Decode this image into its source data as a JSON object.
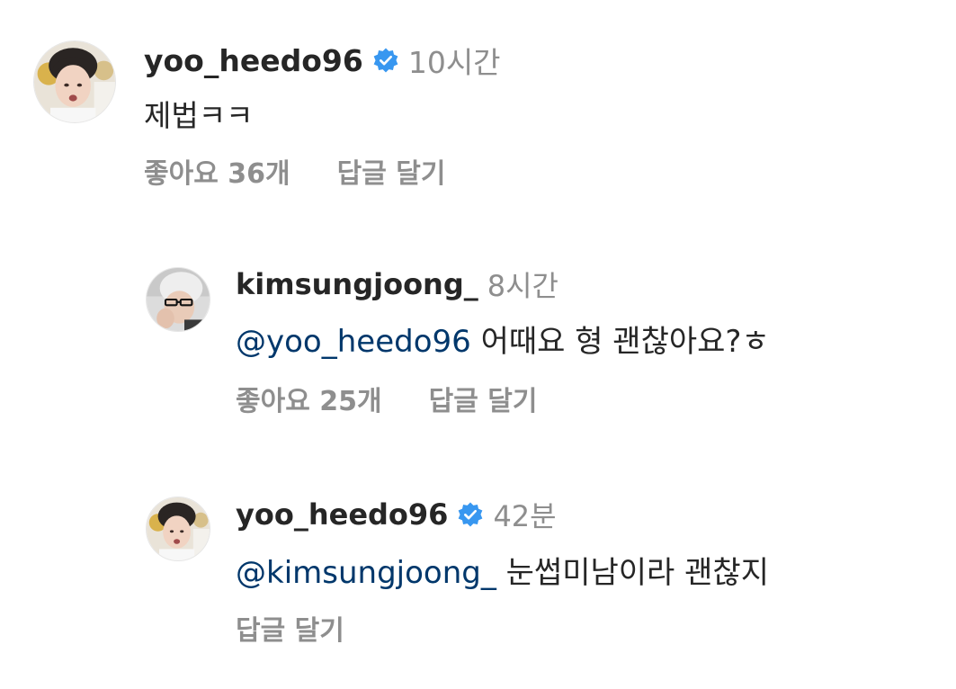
{
  "comments": [
    {
      "username": "yoo_heedo96",
      "verified": true,
      "time": "10시간",
      "mention": "",
      "text": "제법ㅋㅋ",
      "likes": "좋아요 36개",
      "reply": "답글 달기",
      "avatar_icon": "profile-photo"
    },
    {
      "username": "kimsungjoong_",
      "verified": false,
      "time": "8시간",
      "mention": "@yoo_heedo96",
      "text": " 어때요 형 괜찮아요?ㅎ",
      "likes": "좋아요 25개",
      "reply": "답글 달기",
      "avatar_icon": "profile-photo"
    },
    {
      "username": "yoo_heedo96",
      "verified": true,
      "time": "42분",
      "mention": "@kimsungjoong_",
      "text": " 눈썹미남이라 괜찮지",
      "likes": "",
      "reply": "답글 달기",
      "avatar_icon": "profile-photo"
    }
  ],
  "colors": {
    "username": "#262626",
    "meta": "#8e8e8e",
    "mention": "#00376b",
    "verified": "#3897f0"
  }
}
